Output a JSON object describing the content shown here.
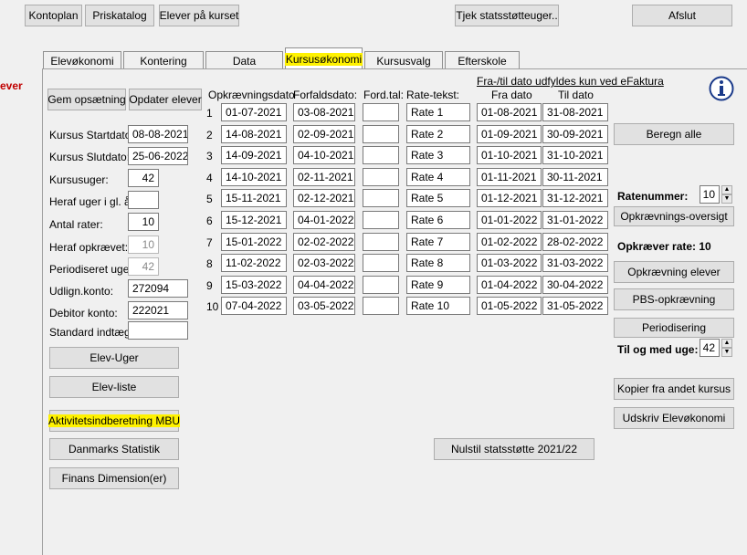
{
  "toolbar": {
    "kontoplan": "Kontoplan",
    "priskatalog": "Priskatalog",
    "elever_paa_kurset": "Elever på kurset",
    "tjek": "Tjek statsstøtteuger..",
    "afslut": "Afslut"
  },
  "side_label": "ever",
  "tabs": [
    "Elevøkonomi",
    "Kontering",
    "Data",
    "Kursusøkonomi",
    "Kursusvalg",
    "Efterskole"
  ],
  "buttons": {
    "gem": "Gem opsætning",
    "opdater": "Opdater elever",
    "elev_uger": "Elev-Uger",
    "elev_liste": "Elev-liste",
    "aktivitet": "Aktivitetsindberetning MBU",
    "danmarks": "Danmarks Statistik",
    "finans": "Finans Dimension(er)",
    "nulstil": "Nulstil statsstøtte 2021/22",
    "beregn": "Beregn alle",
    "opkr_oversigt": "Opkrævnings-oversigt",
    "opkr_elever": "Opkrævning elever",
    "pbs": "PBS-opkrævning",
    "periodisering": "Periodisering",
    "kopier": "Kopier fra andet kursus",
    "udskriv": "Udskriv Elevøkonomi"
  },
  "fields": {
    "startdato_label": "Kursus Startdato:",
    "startdato": "08-08-2021",
    "slutdato_label": "Kursus Slutdato:",
    "slutdato": "25-06-2022",
    "kursusuger_label": "Kursusuger:",
    "kursusuger": "42",
    "heraf_gl_label": "Heraf uger i gl. år",
    "heraf_gl": "",
    "antal_rater_label": "Antal rater:",
    "antal_rater": "10",
    "heraf_opkr_label": "Heraf opkrævet:",
    "heraf_opkr": "10",
    "periodiseret_label": "Periodiseret uger:",
    "periodiseret": "42",
    "udlign_label": "Udlign.konto:",
    "udlign": "272094",
    "debitor_label": "Debitor konto:",
    "debitor": "222021",
    "standard_label": "Standard indtægt:",
    "standard": ""
  },
  "table": {
    "note": "Fra-/til dato udfyldes kun ved eFaktura",
    "headers": [
      "Opkrævningsdato",
      "Forfaldsdato:",
      "Ford.tal:",
      "Rate-tekst:",
      "Fra dato",
      "Til dato"
    ],
    "rows": [
      {
        "n": "1",
        "opkr": "01-07-2021",
        "forf": "03-08-2021",
        "ford": "",
        "tekst": "Rate 1",
        "fra": "01-08-2021",
        "til": "31-08-2021"
      },
      {
        "n": "2",
        "opkr": "14-08-2021",
        "forf": "02-09-2021",
        "ford": "",
        "tekst": "Rate 2",
        "fra": "01-09-2021",
        "til": "30-09-2021"
      },
      {
        "n": "3",
        "opkr": "14-09-2021",
        "forf": "04-10-2021",
        "ford": "",
        "tekst": "Rate 3",
        "fra": "01-10-2021",
        "til": "31-10-2021"
      },
      {
        "n": "4",
        "opkr": "14-10-2021",
        "forf": "02-11-2021",
        "ford": "",
        "tekst": "Rate 4",
        "fra": "01-11-2021",
        "til": "30-11-2021"
      },
      {
        "n": "5",
        "opkr": "15-11-2021",
        "forf": "02-12-2021",
        "ford": "",
        "tekst": "Rate 5",
        "fra": "01-12-2021",
        "til": "31-12-2021"
      },
      {
        "n": "6",
        "opkr": "15-12-2021",
        "forf": "04-01-2022",
        "ford": "",
        "tekst": "Rate 6",
        "fra": "01-01-2022",
        "til": "31-01-2022"
      },
      {
        "n": "7",
        "opkr": "15-01-2022",
        "forf": "02-02-2022",
        "ford": "",
        "tekst": "Rate 7",
        "fra": "01-02-2022",
        "til": "28-02-2022"
      },
      {
        "n": "8",
        "opkr": "11-02-2022",
        "forf": "02-03-2022",
        "ford": "",
        "tekst": "Rate 8",
        "fra": "01-03-2022",
        "til": "31-03-2022"
      },
      {
        "n": "9",
        "opkr": "15-03-2022",
        "forf": "04-04-2022",
        "ford": "",
        "tekst": "Rate 9",
        "fra": "01-04-2022",
        "til": "30-04-2022"
      },
      {
        "n": "10",
        "opkr": "07-04-2022",
        "forf": "03-05-2022",
        "ford": "",
        "tekst": "Rate 10",
        "fra": "01-05-2022",
        "til": "31-05-2022"
      }
    ]
  },
  "right": {
    "ratenummer_label": "Ratenummer:",
    "ratenummer": "10",
    "opkraever_rate": "Opkræver rate: 10",
    "til_og_med_label": "Til og med uge:",
    "til_og_med": "42"
  },
  "colors": {
    "highlight": "#fff200",
    "side_label": "#c00000",
    "info_icon": "#1a3a8a"
  }
}
